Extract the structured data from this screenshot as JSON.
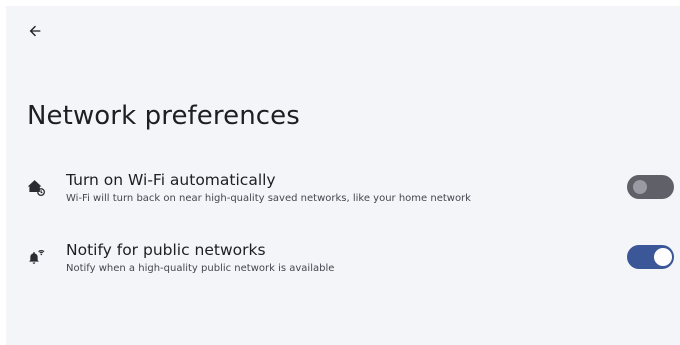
{
  "header": {
    "title": "Network preferences",
    "back_icon": "back-arrow-icon"
  },
  "preferences": [
    {
      "title": "Turn on Wi-Fi automatically",
      "summary": "Wi-Fi will turn back on near high-quality saved networks, like your home network",
      "icon": "wifi-home-auto-icon",
      "enabled": false
    },
    {
      "title": "Notify for public networks",
      "summary": "Notify when a high-quality public network is available",
      "icon": "wifi-notification-icon",
      "enabled": true
    }
  ],
  "colors": {
    "background": "#f4f5f8",
    "toggle_on_track": "#3c5798",
    "toggle_off_track": "#5f6068"
  }
}
